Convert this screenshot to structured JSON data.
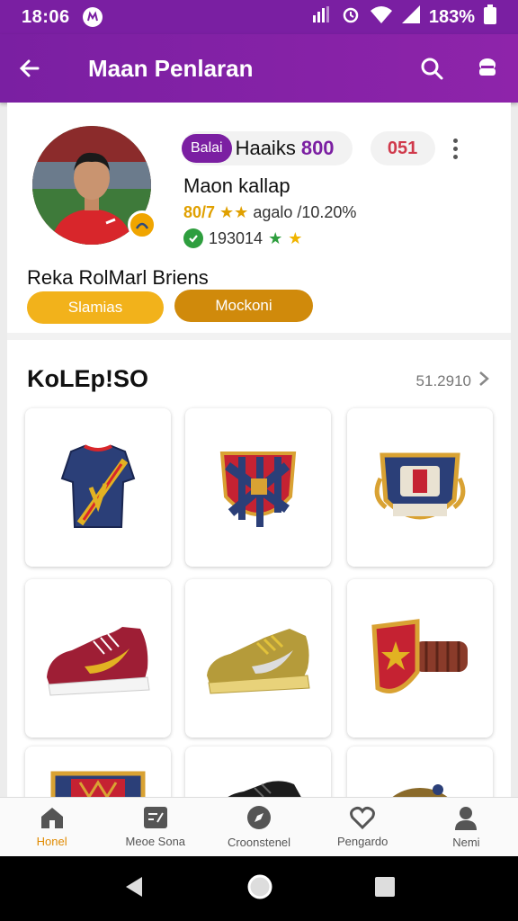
{
  "status": {
    "time": "18:06",
    "battery": "183%"
  },
  "appbar": {
    "title": "Maan Penlaran"
  },
  "profile": {
    "badge": "Balai",
    "handle": "Haaiks",
    "score": "800",
    "red_chip": "051",
    "name": "Maon kallap",
    "rank_gold": "80/7 ★★",
    "rank_rest": "agalo /10.20%",
    "stat": "193014",
    "subtitle": "Reka RolMarl Briens",
    "btn_primary": "Slamias",
    "btn_secondary": "Mockoni"
  },
  "section": {
    "title": "KoLEp!SO",
    "more": "51.2910"
  },
  "products": [
    {
      "name": "jersey",
      "icon": "jersey-icon"
    },
    {
      "name": "shield-crest",
      "icon": "crest-icon"
    },
    {
      "name": "club-badge",
      "icon": "badge-icon"
    },
    {
      "name": "red-sneaker",
      "icon": "sneaker-icon"
    },
    {
      "name": "gold-sneaker",
      "icon": "sneaker-icon"
    },
    {
      "name": "shield-gauntlet",
      "icon": "gauntlet-icon"
    },
    {
      "name": "crest-partial",
      "icon": "crest-icon"
    },
    {
      "name": "black-boot",
      "icon": "boot-icon"
    },
    {
      "name": "ball-partial",
      "icon": "ball-icon"
    }
  ],
  "nav": [
    {
      "label": "Honel",
      "icon": "home-icon",
      "active": true
    },
    {
      "label": "Meoe Sona",
      "icon": "chat-icon",
      "active": false
    },
    {
      "label": "Croonstenel",
      "icon": "compass-icon",
      "active": false
    },
    {
      "label": "Pengardo",
      "icon": "heart-icon",
      "active": false
    },
    {
      "label": "Nemi",
      "icon": "person-icon",
      "active": false
    }
  ],
  "colors": {
    "primary": "#7a1fa2",
    "accent": "#f2b21b",
    "accent_dark": "#d08a0b",
    "active_nav": "#e08a00"
  }
}
